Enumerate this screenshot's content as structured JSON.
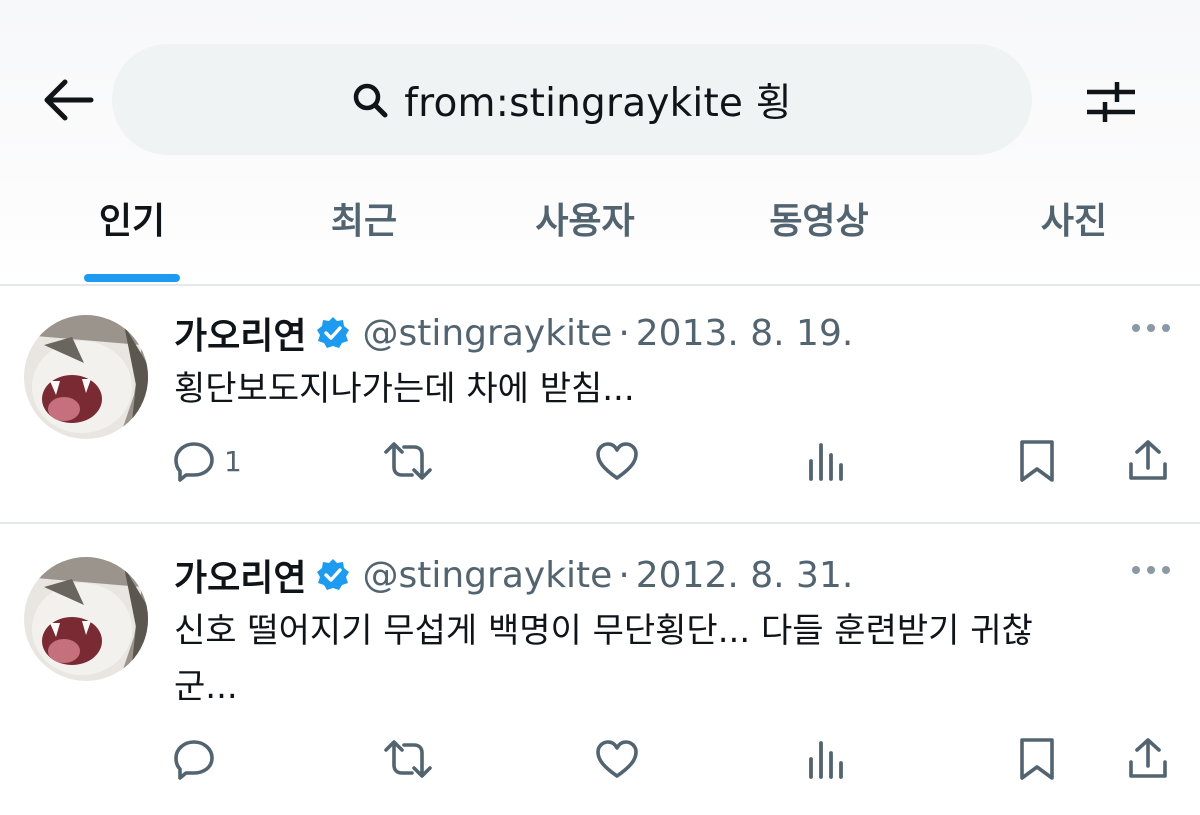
{
  "search": {
    "query": "from:stingraykite 횡"
  },
  "tabs": [
    {
      "label": "인기",
      "active": true
    },
    {
      "label": "최근"
    },
    {
      "label": "사용자"
    },
    {
      "label": "동영상"
    },
    {
      "label": "사진"
    }
  ],
  "tweets": [
    {
      "name": "가오리연",
      "handle": "@stingraykite",
      "separator": "·",
      "date": "2013. 8. 19.",
      "text_lines": [
        "횡단보도지나가는데 차에 받침..."
      ],
      "reply_count": "1"
    },
    {
      "name": "가오리연",
      "handle": "@stingraykite",
      "separator": "·",
      "date": "2012. 8. 31.",
      "text_lines": [
        "신호 떨어지기 무섭게 백명이 무단횡단... 다들 훈련받기 귀찮",
        "군..."
      ],
      "reply_count": ""
    }
  ],
  "colors": {
    "accent": "#1d9bf0",
    "secondary_text": "#536471",
    "primary_text": "#0f1419"
  },
  "icons": [
    "back-arrow-icon",
    "search-icon",
    "filter-sliders-icon",
    "verified-badge-icon",
    "more-icon",
    "reply-icon",
    "retweet-icon",
    "like-icon",
    "views-icon",
    "bookmark-icon",
    "share-icon"
  ]
}
